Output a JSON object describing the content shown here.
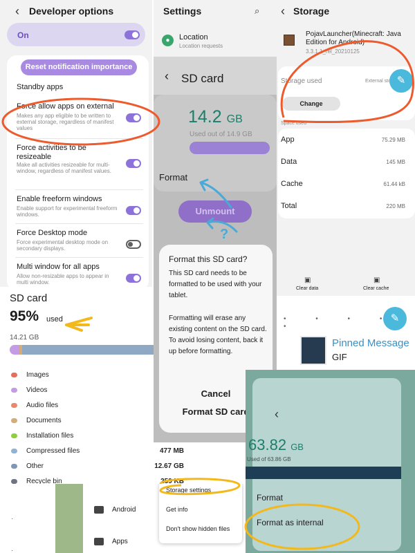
{
  "dev": {
    "title": "Developer options",
    "on_label": "On",
    "reset_button": "Reset notification importance",
    "standby": "Standby apps",
    "items": [
      {
        "title": "Force allow apps on external",
        "desc": "Makes any app eligible to be written to external storage, regardless of manifest values",
        "toggle": "on"
      },
      {
        "title": "Force activities to be resizeable",
        "desc": "Make all activities resizeable for multi-window, regardless of manifest values.",
        "toggle": "on"
      },
      {
        "title": "Enable freeform windows",
        "desc": "Enable support for experimental freeform windows.",
        "toggle": "on"
      },
      {
        "title": "Force Desktop mode",
        "desc": "Force experimental desktop mode on secondary displays.",
        "toggle": "off"
      },
      {
        "title": "Multi window for all apps",
        "desc": "Allow non-resizable apps to appear in multi window.",
        "toggle": "on"
      }
    ]
  },
  "settings": {
    "title": "Settings",
    "location": "Location",
    "location_sub": "Location requests"
  },
  "sdcard_dialog": {
    "title": "SD card",
    "size": "14.2",
    "unit": "GB",
    "used_of": "Used out of 14.9 GB",
    "format": "Format",
    "unmount": "Unmount",
    "question": "?",
    "dialog_title": "Format this SD card?",
    "dialog_body1": "This SD card needs to be formatted to be used with your tablet.",
    "dialog_body2": "Formatting will erase any existing content on the SD card. To avoid losing content, back it up before formatting.",
    "cancel": "Cancel",
    "confirm": "Format SD card"
  },
  "storage": {
    "title": "Storage",
    "app_name": "PojavLauncher(Minecraft: Java Edition for Android)",
    "version": "3.3.1.1_rel_20210125",
    "storage_used": "Storage used",
    "external": "External storage",
    "change": "Change",
    "space_used": "Space used",
    "rows": [
      {
        "label": "App",
        "value": "75.29 MB"
      },
      {
        "label": "Data",
        "value": "145 MB"
      },
      {
        "label": "Cache",
        "value": "61.44 kB"
      },
      {
        "label": "Total",
        "value": "220 MB"
      }
    ],
    "clear_data": "Clear data",
    "clear_cache": "Clear cache"
  },
  "sd_usage": {
    "title": "SD card",
    "percent": "95%",
    "used": "used",
    "total": "14.21 GB",
    "used_fraction": 0.95,
    "categories": [
      {
        "label": "Images",
        "color": "#e46f5c",
        "value": ""
      },
      {
        "label": "Videos",
        "color": "#c49ce5",
        "value": ""
      },
      {
        "label": "Audio files",
        "color": "#e8896b",
        "value": ""
      },
      {
        "label": "Documents",
        "color": "#d6ab7a",
        "value": ""
      },
      {
        "label": "Installation files",
        "color": "#8fcf3c",
        "value": ""
      },
      {
        "label": "Compressed files",
        "color": "#8fb3d3",
        "value": "477 MB"
      },
      {
        "label": "Other",
        "color": "#7d97b7",
        "value": "12.67 GB"
      },
      {
        "label": "Recycle bin",
        "color": "#6f7384",
        "value": "259 KB"
      }
    ]
  },
  "files": {
    "folders": [
      "Android",
      "Apps"
    ],
    "menu": [
      "Storage settings",
      "Get info",
      "Don't show hidden files"
    ]
  },
  "pinned": {
    "title": "Pinned Message",
    "sub": "GIF",
    "size": "63.82",
    "unit": "GB",
    "used_of": "Used of 63.86 GB",
    "format": "Format",
    "format_internal": "Format as internal"
  },
  "colors": {
    "purple": "#8c72d9",
    "teal": "#1e7d6a",
    "annotation_orange": "#ec5a2d",
    "annotation_yellow": "#f2b81c",
    "annotation_blue": "#4aa9d6"
  }
}
